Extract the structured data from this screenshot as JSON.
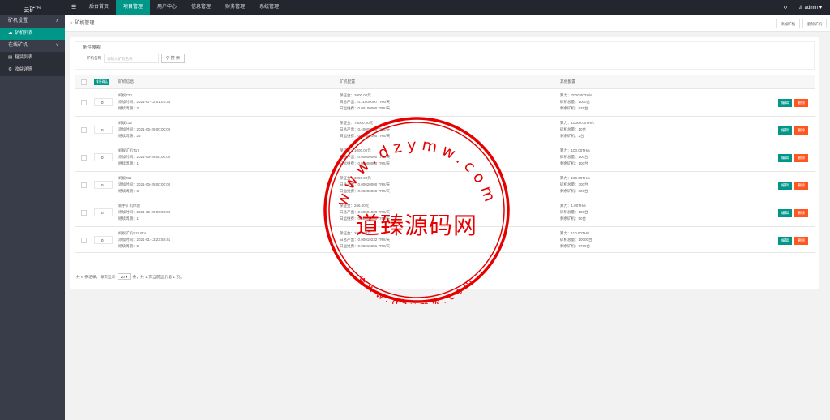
{
  "topbar": {
    "logo": "云矿",
    "logo_sup": "TP6",
    "menu_toggle": "☰",
    "nav": [
      "后台首页",
      "项目管理",
      "用户中心",
      "信息管理",
      "财务管理",
      "系统管理"
    ],
    "active_nav": "项目管理",
    "refresh_icon": "↻",
    "user_icon": "♙",
    "user": "admin",
    "user_chevron": "▾"
  },
  "sidebar": {
    "group1": "矿机设置",
    "group1_items": [
      "矿机列表"
    ],
    "group2": "在线矿机",
    "group2_items": [
      "租赁列表",
      "收益详情"
    ],
    "chevron_up": "∧",
    "chevron_down": "∨"
  },
  "breadcrumb": {
    "arrow": "»",
    "text": "矿机管理",
    "add_button": "添加矿机",
    "delete_button": "删除矿机"
  },
  "filter": {
    "legend": "条件搜索",
    "label": "矿机名称",
    "placeholder": "请输入矿机名称",
    "search_icon": "⚲",
    "search_button": "搜 索"
  },
  "table": {
    "sort_button": "排序确认",
    "headers": [
      "矿机信息",
      "矿机配置",
      "其他配置"
    ],
    "edit_label": "编辑",
    "delete_label": "删除",
    "rows": [
      {
        "sort": "0",
        "info": [
          "蚂蚁Z20",
          "添加时间：2021-07-12 01:07:38",
          "继续周期：3"
        ],
        "config": [
          "保证金：2000.00元",
          "日总产出：0.11000000 TRX/天",
          "日运维费：0.00100000 TRX/天"
        ],
        "other": [
          "算力：7000.00TH/s",
          "矿机总量：1000台",
          "剩余矿机：825台"
        ]
      },
      {
        "sort": "0",
        "info": [
          "蚂蚁Z15",
          "添加时间：2021-05-29 00:00:00",
          "继续周期：25"
        ],
        "config": [
          "保证金：76000.00元",
          "日总产出：0.40000000 TRX/天",
          "日运维费：0.00000000 TRX/天"
        ],
        "other": [
          "算力：10000.00TH/s",
          "矿机总量：10台",
          "剩余矿机：2台"
        ]
      },
      {
        "sort": "0",
        "info": [
          "蚂蚁矿机T17",
          "添加时间：2021-05-29 00:00:00",
          "继续周期：1"
        ],
        "config": [
          "保证金：1000.00元",
          "日总产出：0.00000000 TRX/天",
          "日运维费：0.00000000 TRX/天"
        ],
        "other": [
          "算力：100.00TH/s",
          "矿机总量：100台",
          "剩余矿机：100台"
        ]
      },
      {
        "sort": "0",
        "info": [
          "蚂蚁Z11",
          "添加时间：2021-05-29 00:00:00",
          "继续周期：3"
        ],
        "config": [
          "保证金：3000.00元",
          "日总产出：0.00020000 TRX/天",
          "日运维费：0.00000000 TRX/天"
        ],
        "other": [
          "算力：100.00TH/s",
          "矿机总量：300台",
          "剩余矿机：300台"
        ]
      },
      {
        "sort": "0",
        "info": [
          "新手矿机体验",
          "添加时间：2021-05-29 00:00:00",
          "继续周期：1"
        ],
        "config": [
          "保证金：266.00元",
          "日总产出：0.00001000 TRX/天",
          "日运维费：0.00000000 TRX/天"
        ],
        "other": [
          "算力：1.00TH/s",
          "矿机总量：100台",
          "剩余矿机：50台"
        ]
      },
      {
        "sort": "0",
        "info": [
          "蚂蚁矿机S19 Pro",
          "添加时间：2021-01-13 23:58:41",
          "继续周期：2"
        ],
        "config": [
          "保证金：2000.00元",
          "日总产出：0.00019232 TRX/天",
          "日运维费：0.00015081 TRX/天"
        ],
        "other": [
          "算力：110.00TH/s",
          "矿机总量：10000台",
          "剩余矿机：9769台"
        ]
      }
    ]
  },
  "pager": {
    "prefix": "共 6 条记录，每页显示",
    "page_size": "20 ▾",
    "suffix": "条，共 1 页当前显示第 1 页。"
  },
  "watermark": {
    "center": "道臻源码网",
    "ring_top": "www.dzymw.com",
    "ring_bottom": "www.dzymw.com",
    "color": "#e60000"
  }
}
